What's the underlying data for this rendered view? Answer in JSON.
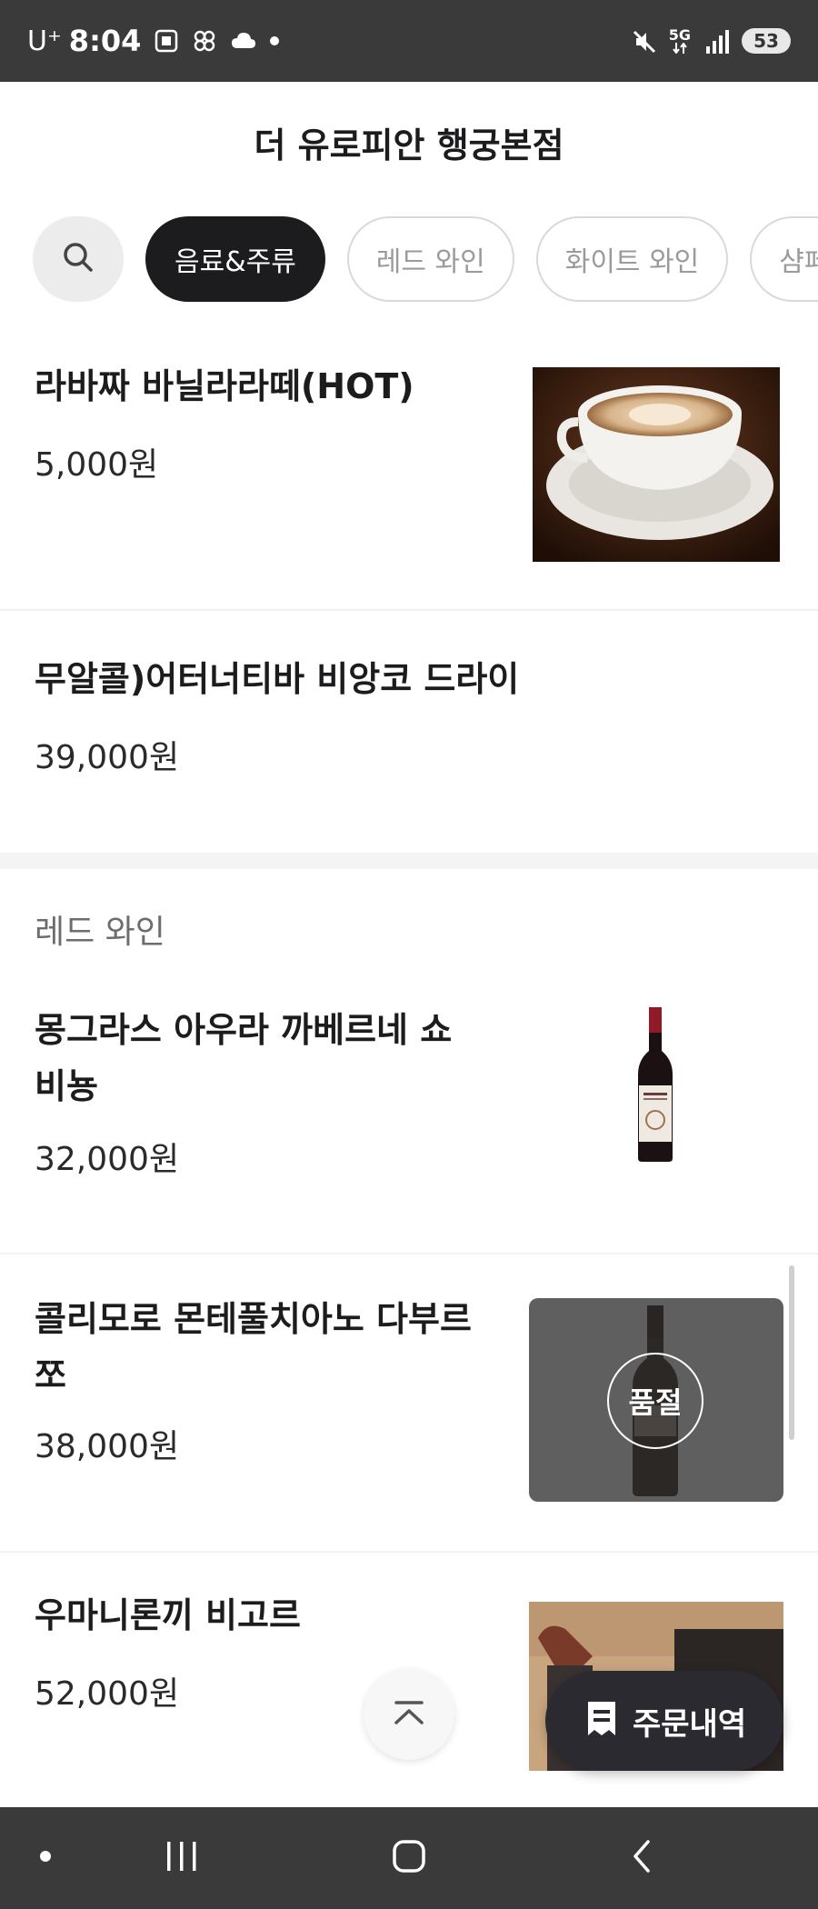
{
  "status_bar": {
    "carrier": "U⁺",
    "time": "8:04",
    "network": "5G",
    "battery": "53"
  },
  "store": {
    "title": "더 유로피안 행궁본점"
  },
  "categories": [
    {
      "label": "음료&주류",
      "active": true
    },
    {
      "label": "레드 와인",
      "active": false
    },
    {
      "label": "화이트 와인",
      "active": false
    },
    {
      "label": "샴페인",
      "active": false
    }
  ],
  "menu": {
    "drinks_items": [
      {
        "name": "라바짜 바닐라라떼(HOT)",
        "price": "5,000원",
        "image": "latte-cup"
      },
      {
        "name": "무알콜)어터너티바 비앙코 드라이",
        "price": "39,000원"
      }
    ],
    "red_wine_section_title": "레드 와인",
    "red_wine_items": [
      {
        "name": "몽그라스 아우라 까베르네 쇼비뇽",
        "price": "32,000원",
        "image": "wine-bottle-red-label"
      },
      {
        "name": "콜리모로 몬테풀치아노 다부르쪼",
        "price": "38,000원",
        "image": "wine-bottle-dark",
        "badge": "품절"
      },
      {
        "name": "우마니론끼 비고르",
        "price": "52,000원",
        "image": "wine-pouring-photo"
      }
    ]
  },
  "floating": {
    "order_history_label": "주문내역"
  },
  "icons": {
    "search": "search-icon",
    "scroll_top": "chevron-up-icon",
    "receipt": "receipt-icon"
  },
  "colors": {
    "active_chip": "#1c1c1e",
    "order_button": "#2a2a30",
    "sold_out_overlay": "#5f5f5f"
  }
}
